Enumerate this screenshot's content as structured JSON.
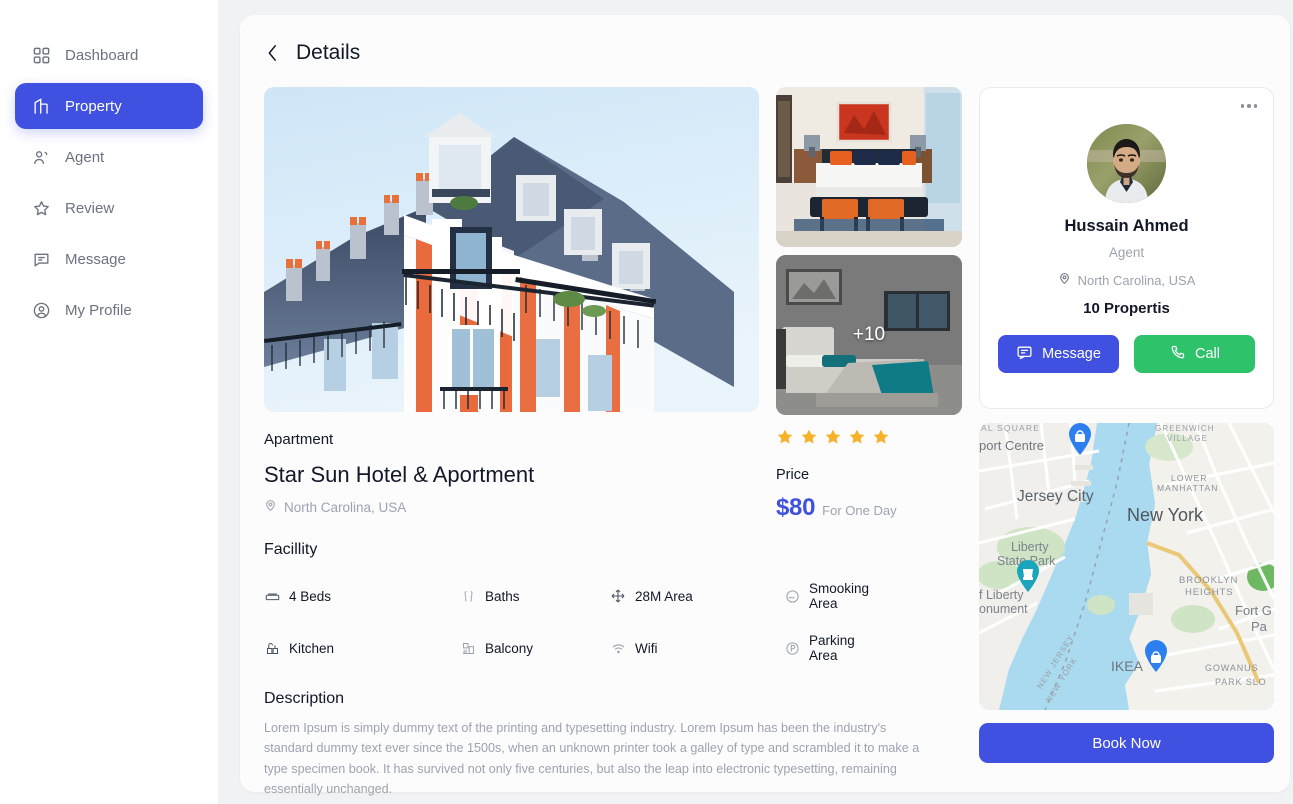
{
  "sidebar": {
    "items": [
      {
        "label": "Dashboard",
        "icon": "grid-icon",
        "active": false
      },
      {
        "label": "Property",
        "icon": "building-icon",
        "active": true
      },
      {
        "label": "Agent",
        "icon": "users-icon",
        "active": false
      },
      {
        "label": "Review",
        "icon": "star-icon",
        "active": false
      },
      {
        "label": "Message",
        "icon": "chat-icon",
        "active": false
      },
      {
        "label": "My Profile",
        "icon": "user-circle-icon",
        "active": false
      }
    ]
  },
  "header": {
    "title": "Details",
    "back_icon": "chevron-left-icon"
  },
  "gallery": {
    "hero_alt": "apartment-building-exterior",
    "thumbs": [
      {
        "alt": "bedroom-orange-interior",
        "overlay": ""
      },
      {
        "alt": "bedroom-grey-interior",
        "overlay": "+10"
      }
    ],
    "more_count": "+10"
  },
  "property": {
    "type": "Apartment",
    "name": "Star Sun Hotel & Aportment",
    "location": "North Carolina, USA",
    "location_icon": "location-pin-icon",
    "rating": 5,
    "rating_max": 5,
    "star_color": "#f5b229",
    "price_label": "Price",
    "price": "$80",
    "price_unit": "For One Day",
    "price_color": "#4050e0"
  },
  "facility": {
    "title": "Facillity",
    "items": [
      {
        "label": "4 Beds",
        "icon": "bed-icon"
      },
      {
        "label": "Baths",
        "icon": "bath-icon"
      },
      {
        "label": "28M Area",
        "icon": "area-expand-icon"
      },
      {
        "label": "Smooking Area",
        "icon": "no-smoking-icon"
      },
      {
        "label": "Kitchen",
        "icon": "kitchen-icon"
      },
      {
        "label": "Balcony",
        "icon": "balcony-icon"
      },
      {
        "label": "Wifi",
        "icon": "wifi-icon"
      },
      {
        "label": "Parking Area",
        "icon": "parking-icon"
      }
    ]
  },
  "description": {
    "title": "Description",
    "body": "Lorem Ipsum is simply dummy text of the printing and typesetting industry. Lorem Ipsum has been the industry's standard dummy text ever since the 1500s, when an unknown printer took a galley of type and scrambled it to make a type specimen book. It has survived not only five centuries, but also the leap into electronic typesetting, remaining essentially unchanged."
  },
  "agent": {
    "menu_icon": "more-horizontal-icon",
    "avatar_alt": "agent-portrait",
    "name": "Hussain Ahmed",
    "role": "Agent",
    "location": "North Carolina, USA",
    "location_icon": "location-pin-icon",
    "properties": "10 Propertis",
    "message_label": "Message",
    "message_icon": "chat-icon",
    "message_color": "#4050e0",
    "call_label": "Call",
    "call_icon": "phone-icon",
    "call_color": "#2ec26a"
  },
  "map": {
    "labels": [
      "AL SQUARE",
      "GREENWICH VILLAGE",
      "port Centre",
      "Jersey City",
      "LOWER MANHATTAN",
      "New York",
      "Liberty State Park",
      "f Liberty",
      "onument",
      "BROOKLYN HEIGHTS",
      "Fort G",
      "Pa",
      "NEW JERSEY",
      "NEW YORK",
      "IKEA",
      "GOWANUS",
      "PARK SLO"
    ],
    "markers": [
      "shop-pin-icon",
      "monument-pin-icon",
      "shop-pin-icon"
    ]
  },
  "book": {
    "label": "Book Now",
    "color": "#4050e0"
  }
}
